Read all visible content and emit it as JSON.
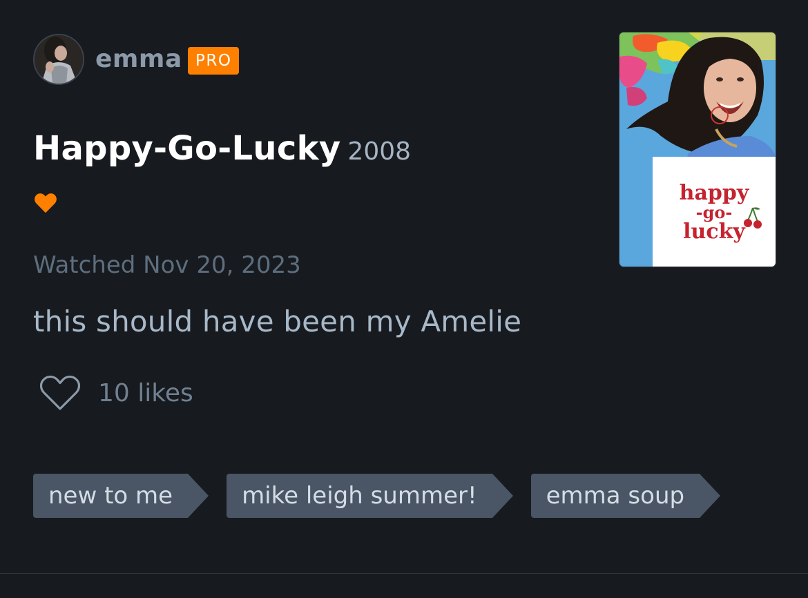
{
  "user": {
    "name": "emma",
    "badge": "PRO"
  },
  "film": {
    "title": "Happy-Go-Lucky",
    "year": "2008",
    "poster_title_lines": [
      "happy",
      "-go-",
      "lucky"
    ]
  },
  "entry": {
    "liked": true,
    "watched_text": "Watched Nov 20, 2023",
    "review": "this should have been my Amelie"
  },
  "likes": {
    "count_text": "10 likes"
  },
  "tags": [
    "new to me",
    "mike leigh summer!",
    "emma soup"
  ],
  "colors": {
    "background": "#171a1f",
    "accent_orange": "#ff8000",
    "tag_bg": "#4a5665",
    "poster_title": "#c52330"
  },
  "icons": {
    "liked": "heart-filled-icon",
    "like_action": "heart-outline-icon"
  }
}
